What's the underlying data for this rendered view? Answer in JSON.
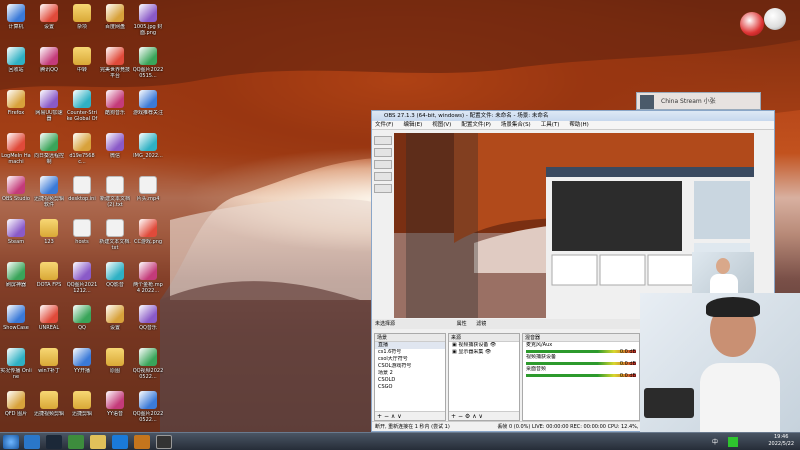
{
  "desktop": {
    "icons": [
      {
        "label": "计算机",
        "cls": "img",
        "col": 0,
        "row": 0
      },
      {
        "label": "设置",
        "cls": "img",
        "col": 1,
        "row": 0
      },
      {
        "label": "杂项",
        "cls": "folder",
        "col": 2,
        "row": 0
      },
      {
        "label": "百度网盘",
        "cls": "img",
        "col": 3,
        "row": 0
      },
      {
        "label": "1005.jpg 封面.png",
        "cls": "img",
        "col": 4,
        "row": 0
      },
      {
        "label": "回收站",
        "cls": "img",
        "col": 0,
        "row": 1
      },
      {
        "label": "腾讯QQ",
        "cls": "img",
        "col": 1,
        "row": 1
      },
      {
        "label": "中转",
        "cls": "folder",
        "col": 2,
        "row": 1
      },
      {
        "label": "完美世界竞技平台",
        "cls": "img",
        "col": 3,
        "row": 1
      },
      {
        "label": "QQ图片20220515...",
        "cls": "img",
        "col": 4,
        "row": 1
      },
      {
        "label": "Firefox",
        "cls": "img",
        "col": 0,
        "row": 2
      },
      {
        "label": "网易UU加速器",
        "cls": "img",
        "col": 1,
        "row": 2
      },
      {
        "label": "Counter-Strike Global Off...",
        "cls": "img",
        "col": 2,
        "row": 2
      },
      {
        "label": "酷狗音乐",
        "cls": "img",
        "col": 3,
        "row": 2
      },
      {
        "label": "游戏推荐关注",
        "cls": "img",
        "col": 4,
        "row": 2
      },
      {
        "label": "LogMeIn Hamachi",
        "cls": "img",
        "col": 0,
        "row": 3
      },
      {
        "label": "向日葵远程控制",
        "cls": "img",
        "col": 1,
        "row": 3
      },
      {
        "label": "d19e7568c...",
        "cls": "img",
        "col": 2,
        "row": 3
      },
      {
        "label": "微信",
        "cls": "img",
        "col": 3,
        "row": 3
      },
      {
        "label": "IMG_2022...",
        "cls": "img",
        "col": 4,
        "row": 3
      },
      {
        "label": "OBS Studio",
        "cls": "img",
        "col": 0,
        "row": 4
      },
      {
        "label": "迅捷视频剪辑软件",
        "cls": "img",
        "col": 1,
        "row": 4
      },
      {
        "label": "desktop.ini",
        "cls": "doc",
        "col": 2,
        "row": 4
      },
      {
        "label": "新建文本文档 (2).txt",
        "cls": "doc",
        "col": 3,
        "row": 4
      },
      {
        "label": "片头.mp4",
        "cls": "doc",
        "col": 4,
        "row": 4
      },
      {
        "label": "Steam",
        "cls": "img",
        "col": 0,
        "row": 5
      },
      {
        "label": "123",
        "cls": "folder",
        "col": 1,
        "row": 5
      },
      {
        "label": "hosts",
        "cls": "doc",
        "col": 2,
        "row": 5
      },
      {
        "label": "新建文本文档.txt",
        "cls": "doc",
        "col": 3,
        "row": 5
      },
      {
        "label": "CC游戏.png",
        "cls": "img",
        "col": 4,
        "row": 5
      },
      {
        "label": "刷屏神器",
        "cls": "img",
        "col": 0,
        "row": 6
      },
      {
        "label": "DOTA FPS",
        "cls": "folder",
        "col": 1,
        "row": 6
      },
      {
        "label": "QQ图片20211212...",
        "cls": "img",
        "col": 2,
        "row": 6
      },
      {
        "label": "QQ影音",
        "cls": "img",
        "col": 3,
        "row": 6
      },
      {
        "label": "两个金枪.mp4 2022...",
        "cls": "img",
        "col": 4,
        "row": 6
      },
      {
        "label": "ShowCase",
        "cls": "img",
        "col": 0,
        "row": 7
      },
      {
        "label": "UNREAL",
        "cls": "img",
        "col": 1,
        "row": 7
      },
      {
        "label": "QQ",
        "cls": "img",
        "col": 2,
        "row": 7
      },
      {
        "label": "设置",
        "cls": "img",
        "col": 3,
        "row": 7
      },
      {
        "label": "QQ音乐",
        "cls": "img",
        "col": 4,
        "row": 7
      },
      {
        "label": "实况传播 Online",
        "cls": "img",
        "col": 0,
        "row": 8
      },
      {
        "label": "win7补丁",
        "cls": "folder",
        "col": 1,
        "row": 8
      },
      {
        "label": "YY开播",
        "cls": "img",
        "col": 2,
        "row": 8
      },
      {
        "label": "原图",
        "cls": "folder",
        "col": 3,
        "row": 8
      },
      {
        "label": "QQ视频20220522...",
        "cls": "img",
        "col": 4,
        "row": 8
      },
      {
        "label": "QFD 图片",
        "cls": "img",
        "col": 0,
        "row": 9
      },
      {
        "label": "迅捷视频剪辑",
        "cls": "folder",
        "col": 1,
        "row": 9
      },
      {
        "label": "迅捷剪辑",
        "cls": "folder",
        "col": 2,
        "row": 9
      },
      {
        "label": "YY语音",
        "cls": "img",
        "col": 3,
        "row": 9
      },
      {
        "label": "QQ图片20220522...",
        "cls": "img",
        "col": 4,
        "row": 9
      }
    ]
  },
  "obs": {
    "title": "OBS 27.1.3 (64-bit, windows) - 配置文件: 未命名 - 场景: 未命名",
    "menu": [
      "文件(F)",
      "编辑(E)",
      "视图(V)",
      "配置文件(P)",
      "场景集合(S)",
      "工具(T)",
      "帮助(H)"
    ],
    "source_bar_label": "未选择源",
    "props_label": "属性",
    "filters_label": "滤镜",
    "scenes_header": "场景",
    "scenes": [
      "直播",
      "cs1.6符号",
      "csol大厅符号",
      "CSOL游戏符号",
      "场景 2",
      "CSOLD",
      "CSGO"
    ],
    "sources_header": "来源",
    "sources": [
      "视频捕获设备",
      "显示器采集"
    ],
    "mixer_header": "混音器",
    "mixer": [
      {
        "name": "麦克风/Aux",
        "db": "0.0 dB"
      },
      {
        "name": "视频捕获设备",
        "db": "0.0 dB"
      },
      {
        "name": "桌面音频",
        "db": "0.0 dB"
      }
    ],
    "status": "断开, 重新连接在 1 秒内 (尝试 1)",
    "status_right": "丢帧 0 (0.0%)   LIVE: 00:00:00   REC: 00:00:00   CPU: 12.4%, 30.00 fps"
  },
  "chat": {
    "name": "China Stream 小张"
  },
  "taskbar": {
    "time": "19:46",
    "date": "2022/5/22",
    "tray_text": "中"
  },
  "colors": {
    "accent": "#4a6fa5",
    "taskbar": "#2a323e"
  }
}
